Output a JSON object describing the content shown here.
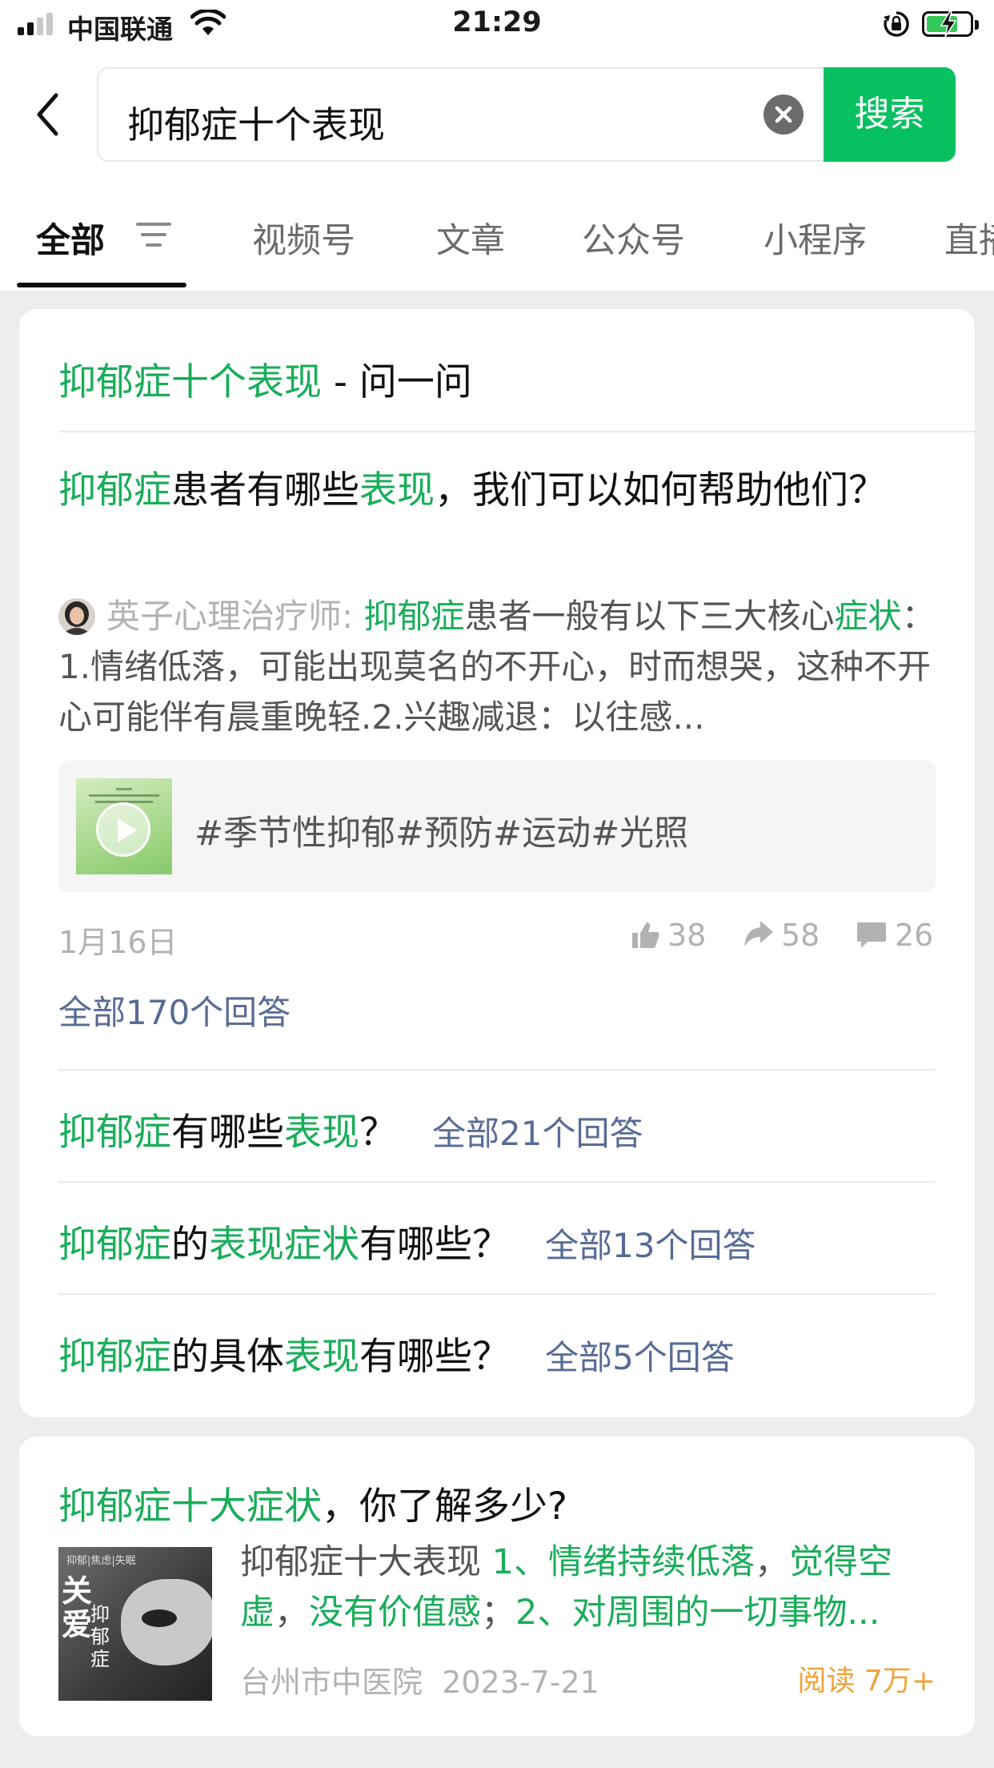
{
  "status_bar": {
    "carrier": "中国联通",
    "time": "21:29"
  },
  "search": {
    "query": "抑郁症十个表现",
    "button": "搜索"
  },
  "tabs": [
    "全部",
    "视频号",
    "文章",
    "公众号",
    "小程序",
    "直播"
  ],
  "qa_card": {
    "title_highlight": "抑郁症十个表现",
    "title_rest": " - 问一问",
    "question": {
      "p1": "抑郁症",
      "p2": "患者有哪些",
      "p3": "表现",
      "p4": "，我们可以如何帮助他们？"
    },
    "answer": {
      "author": "英子心理治疗师:",
      "p1": "抑郁症",
      "p2": "患者一般有以下三大核心",
      "p3": "症状",
      "p4": "：1.情绪低落，可能出现莫名的不开心，时而想哭，这种不开心可能伴有晨重晚轻.2.兴趣减退：以往感..."
    },
    "video_tags": "#季节性抑郁#预防#运动#光照",
    "date": "1月16日",
    "likes": "38",
    "shares": "58",
    "comments": "26",
    "all_answers": "全部170个回答",
    "related": [
      {
        "p1": "抑郁症",
        "p2": "有哪些",
        "p3": "表现",
        "p4": "？",
        "p5": "",
        "p6": "",
        "count": "全部21个回答"
      },
      {
        "p1": "抑郁症",
        "p2": "的",
        "p3": "表现症状",
        "p4": "有哪些？",
        "p5": "",
        "p6": "",
        "count": "全部13个回答"
      },
      {
        "p1": "抑郁症",
        "p2": "的具体",
        "p3": "表现",
        "p4": "有哪些？",
        "p5": "",
        "p6": "",
        "count": "全部5个回答"
      }
    ]
  },
  "article_card": {
    "title_highlight": "抑郁症十大症状",
    "title_rest": "，你了解多少?",
    "thumb_caption": "抑郁|焦虑|失眠",
    "thumb_big": "关爱",
    "thumb_small": "抑郁症",
    "snippet_plain": "抑郁症十大表现 ",
    "snippet_green_1": "1、情绪持续低落",
    "snippet_mid": "，",
    "snippet_green_2": "觉得空虚",
    "snippet_mid2": "，",
    "snippet_green_3": "没有价值感",
    "snippet_mid3": "；",
    "snippet_green_4": "2、对周围的一切事物...",
    "source": "台州市中医院",
    "date": "2023-7-21",
    "reads": "阅读 7万+"
  },
  "colors": {
    "accent_green": "#07c160",
    "highlight_green": "#1aad5a",
    "link_bluegrey": "#576b95",
    "read_orange": "#f0a33a"
  },
  "icons": [
    "back-icon",
    "clear-icon",
    "filter-icon",
    "play-icon",
    "thumbs-up-icon",
    "share-icon",
    "comment-icon",
    "wifi-icon",
    "battery-icon"
  ]
}
